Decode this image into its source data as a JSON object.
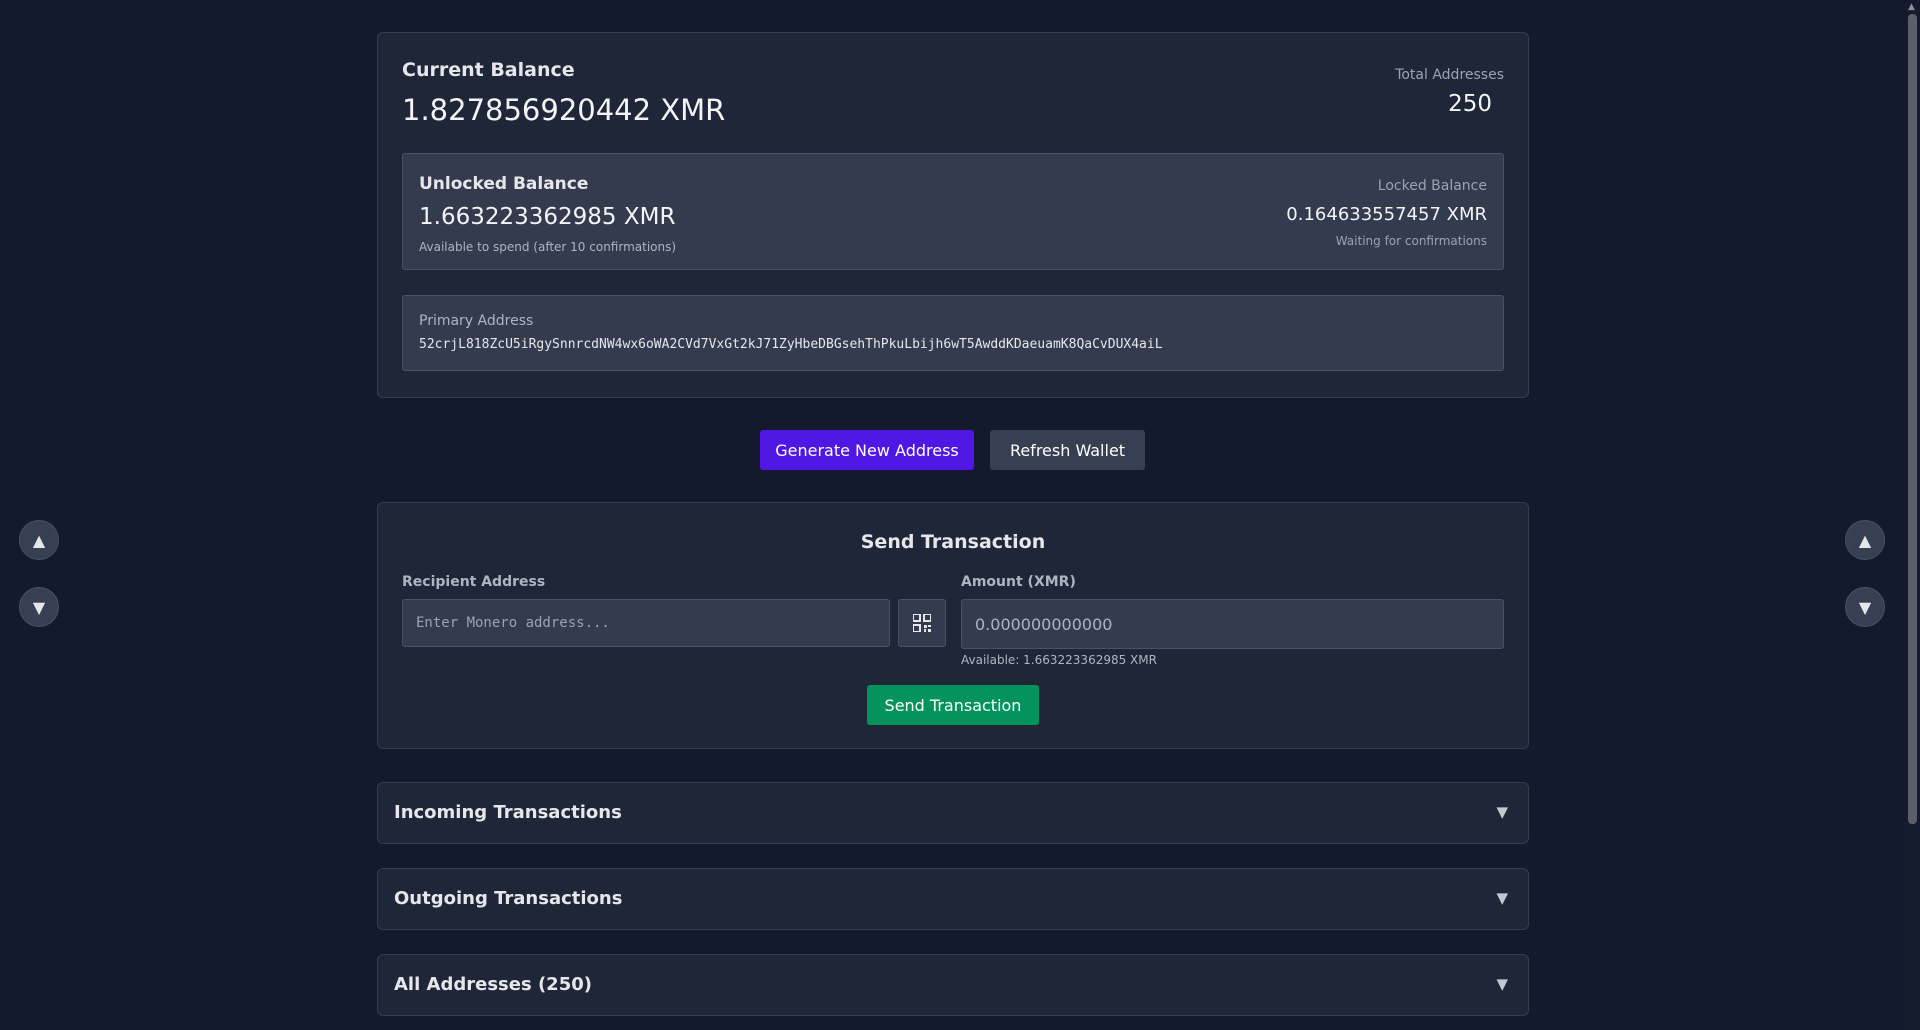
{
  "balance": {
    "current_label": "Current Balance",
    "current_value": "1.827856920442 XMR",
    "total_addresses_label": "Total Addresses",
    "total_addresses_value": "250",
    "unlocked_label": "Unlocked Balance",
    "unlocked_value": "1.663223362985 XMR",
    "unlocked_note": "Available to spend (after 10 confirmations)",
    "locked_label": "Locked Balance",
    "locked_value": "0.164633557457 XMR",
    "locked_note": "Waiting for confirmations",
    "primary_address_label": "Primary Address",
    "primary_address_value": "52crjL818ZcU5iRgySnnrcdNW4wx6oWA2CVd7VxGt2kJ71ZyHbeDBGsehThPkuLbijh6wT5AwddKDaeuamK8QaCvDUX4aiL"
  },
  "actions": {
    "generate_label": "Generate New Address",
    "refresh_label": "Refresh Wallet"
  },
  "send": {
    "title": "Send Transaction",
    "recipient_label": "Recipient Address",
    "recipient_placeholder": "Enter Monero address...",
    "amount_label": "Amount (XMR)",
    "amount_placeholder": "0.000000000000",
    "available_note": "Available: 1.663223362985 XMR",
    "send_label": "Send Transaction",
    "qr_icon": "qr-code-icon"
  },
  "sections": {
    "incoming": "Incoming Transactions",
    "outgoing": "Outgoing Transactions",
    "addresses": "All Addresses (250)"
  },
  "icons": {
    "chevron": "▼",
    "scroll_up": "▲",
    "scroll_down": "▼"
  },
  "colors": {
    "background": "#141a2e",
    "card": "#1f2638",
    "primary_button": "#4f16e4",
    "send_button": "#04935d",
    "secondary_button": "#374052"
  }
}
